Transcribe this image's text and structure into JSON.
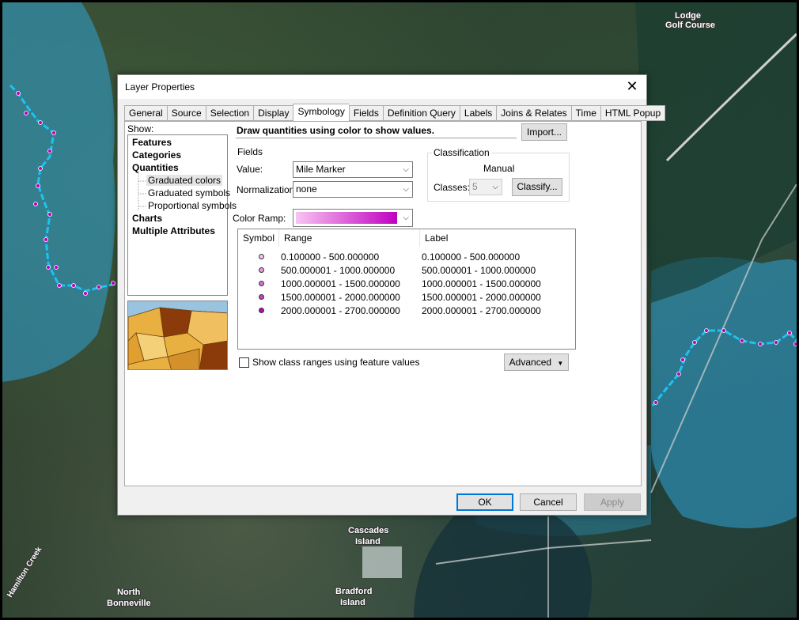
{
  "map": {
    "labels": [
      "Lodge",
      "Golf Course",
      "Cascades",
      "Island",
      "North",
      "Bonneville",
      "Bradford",
      "Island",
      "Hamilton Creek"
    ]
  },
  "dialog": {
    "title": "Layer Properties",
    "tabs": [
      "General",
      "Source",
      "Selection",
      "Display",
      "Symbology",
      "Fields",
      "Definition Query",
      "Labels",
      "Joins & Relates",
      "Time",
      "HTML Popup"
    ],
    "active_tab": "Symbology",
    "show_label": "Show:",
    "tree": {
      "features": "Features",
      "categories": "Categories",
      "quantities": "Quantities",
      "graduated_colors": "Graduated colors",
      "graduated_symbols": "Graduated symbols",
      "proportional_symbols": "Proportional symbols",
      "charts": "Charts",
      "multiple_attributes": "Multiple Attributes"
    },
    "heading": "Draw quantities using color to show values.",
    "import_label": "Import...",
    "fields": {
      "group_title": "Fields",
      "value_label": "Value:",
      "value": "Mile Marker",
      "normalization_label": "Normalization:",
      "normalization": "none"
    },
    "classification": {
      "group_title": "Classification",
      "method": "Manual",
      "classes_label": "Classes:",
      "classes": "5",
      "classify_label": "Classify..."
    },
    "color_ramp_label": "Color Ramp:",
    "colors": {
      "ramp_start": "#f8c4f2",
      "ramp_end": "#c000c0",
      "accent": "#0078d7"
    },
    "table": {
      "headers": [
        "Symbol",
        "Range",
        "Label"
      ],
      "rows": [
        {
          "range": "0.100000 - 500.000000",
          "label": "0.100000 - 500.000000",
          "color": "#f2c6ee"
        },
        {
          "range": "500.000001 - 1000.000000",
          "label": "500.000001 - 1000.000000",
          "color": "#e79be0"
        },
        {
          "range": "1000.000001 - 1500.000000",
          "label": "1000.000001 - 1500.000000",
          "color": "#db6fd3"
        },
        {
          "range": "1500.000001 - 2000.000000",
          "label": "1500.000001 - 2000.000000",
          "color": "#ce3ec7"
        },
        {
          "range": "2000.000001 - 2700.000000",
          "label": "2000.000001 - 2700.000000",
          "color": "#c000c0"
        }
      ]
    },
    "show_ranges_label": "Show class ranges using feature values",
    "advanced_label": "Advanced",
    "ok_label": "OK",
    "cancel_label": "Cancel",
    "apply_label": "Apply"
  }
}
